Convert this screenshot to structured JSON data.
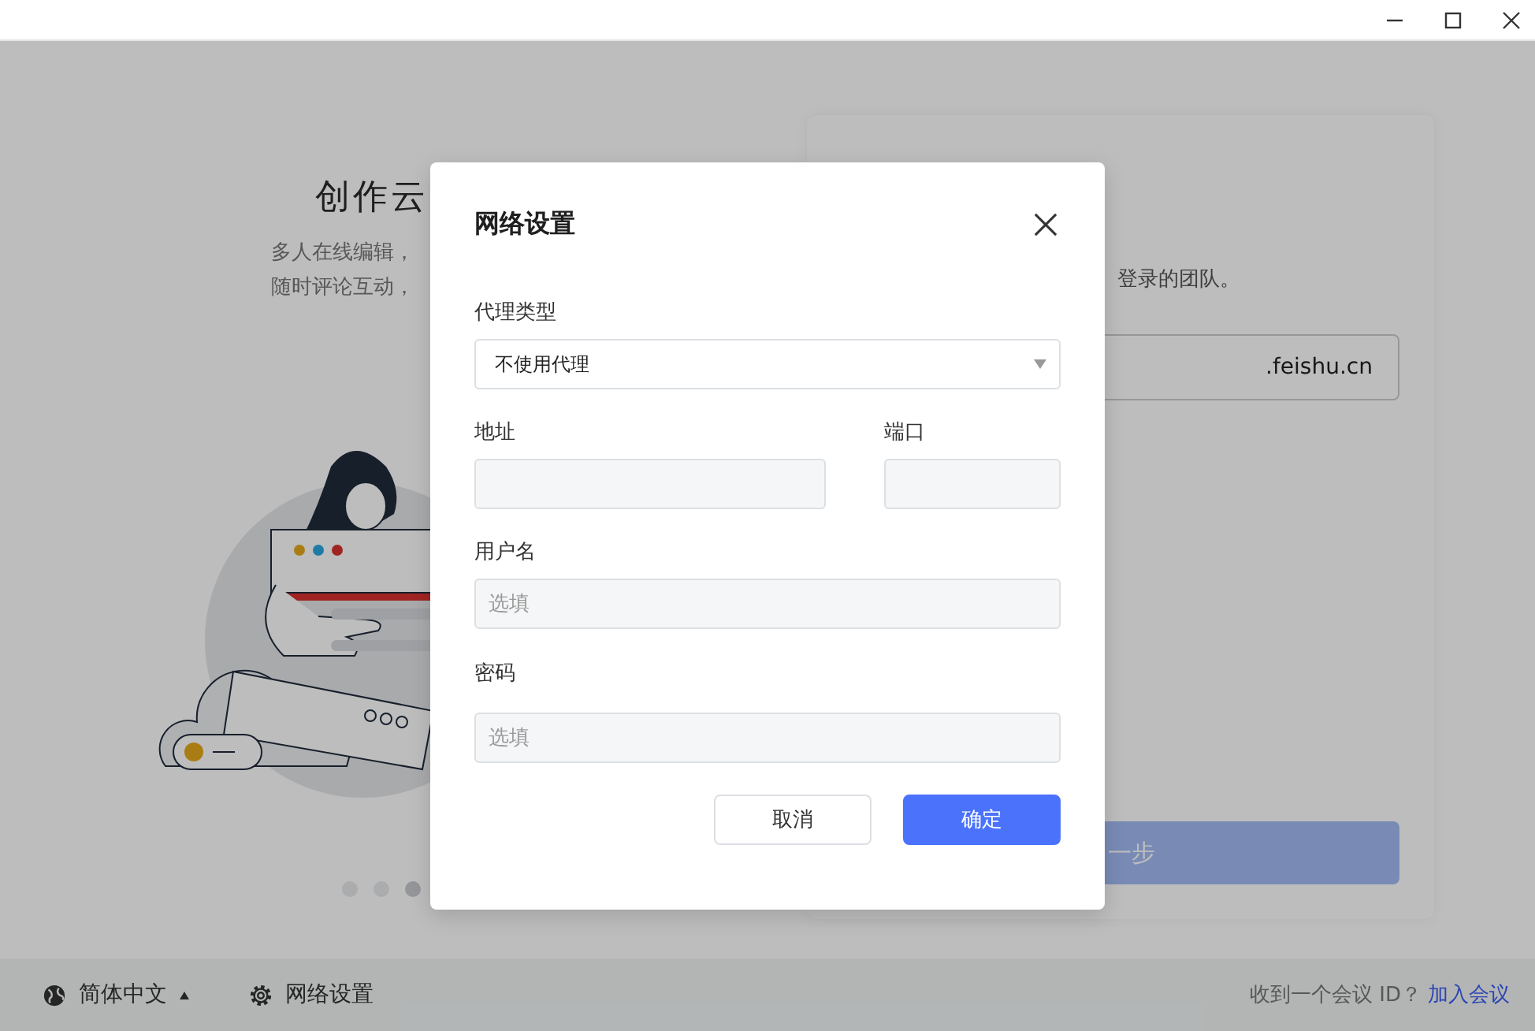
{
  "background": {
    "feature_title": "创作云",
    "feature_lines": [
      "多人在线编辑，",
      "随时评论互动，"
    ],
    "carousel_dots": [
      {
        "selected": false
      },
      {
        "selected": false
      },
      {
        "selected": true
      }
    ],
    "login_card": {
      "hint": "登录的团队。",
      "domain_suffix": ".feishu.cn",
      "next_button": "一步"
    }
  },
  "dialog": {
    "title": "网络设置",
    "proxy_type": {
      "label": "代理类型",
      "value": "不使用代理"
    },
    "address": {
      "label": "地址"
    },
    "port": {
      "label": "端口"
    },
    "username": {
      "label": "用户名",
      "placeholder": "选填"
    },
    "password": {
      "label": "密码",
      "placeholder": "选填"
    },
    "buttons": [
      {
        "label": "取消",
        "kind": "secondary"
      },
      {
        "label": "确定",
        "kind": "primary"
      }
    ]
  },
  "footer": {
    "language": "简体中文",
    "network_settings": "网络设置",
    "meeting_prompt": "收到一个会议 ID？",
    "join_link": "加入会议"
  }
}
